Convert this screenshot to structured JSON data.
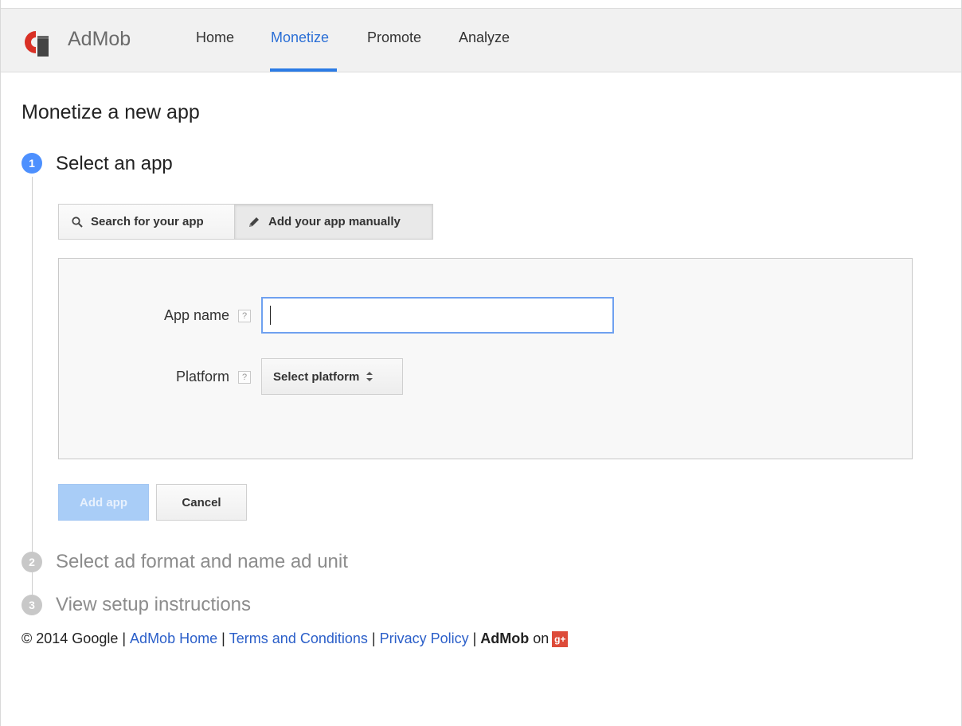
{
  "header": {
    "brand": "AdMob",
    "nav": [
      "Home",
      "Monetize",
      "Promote",
      "Analyze"
    ],
    "active_nav": "Monetize"
  },
  "page_title": "Monetize a new app",
  "steps": [
    {
      "number": "1",
      "title": "Select an app",
      "state": "active"
    },
    {
      "number": "2",
      "title": "Select ad format and name ad unit",
      "state": "inactive"
    },
    {
      "number": "3",
      "title": "View setup instructions",
      "state": "inactive"
    }
  ],
  "tabs": {
    "search_label": "Search for your app",
    "manual_label": "Add your app manually",
    "selected": "Add your app manually"
  },
  "form": {
    "app_name_label": "App name",
    "app_name_value": "",
    "platform_label": "Platform",
    "platform_select_label": "Select platform",
    "help_glyph": "?"
  },
  "actions": {
    "add_label": "Add app",
    "cancel_label": "Cancel"
  },
  "footer": {
    "copyright": "© 2014 Google",
    "link_home": "AdMob Home",
    "link_terms": "Terms and Conditions",
    "link_privacy": "Privacy Policy",
    "admob_bold": "AdMob",
    "on_text": "on",
    "gplus_glyph": "g+"
  },
  "colors": {
    "accent": "#2b7be5",
    "link": "#2b5fc9",
    "step_active": "#4d90fe",
    "step_inactive": "#c8c8c8",
    "add_button_disabled": "#a9cdf7",
    "logo_red": "#d93025",
    "gplus": "#dd4b39"
  }
}
